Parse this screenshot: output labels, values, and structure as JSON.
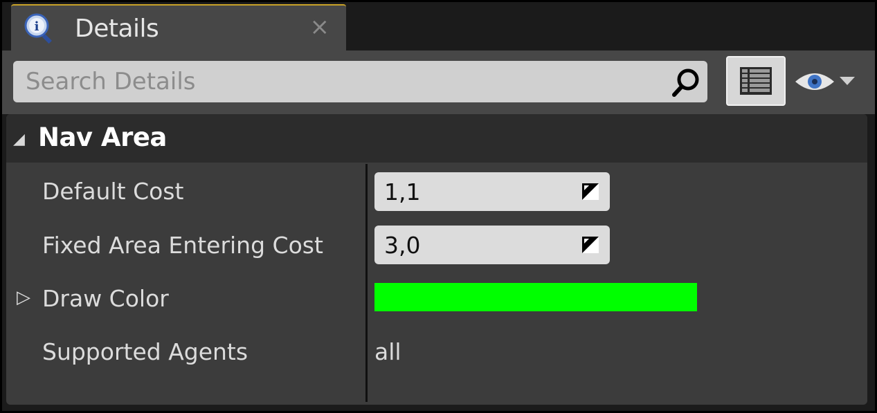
{
  "tab": {
    "title": "Details",
    "close": "×",
    "icon": "details-info-icon"
  },
  "toolbar": {
    "search_placeholder": "Search Details",
    "search_value": "",
    "search_icon": "magnifier-icon",
    "view_options_icon": "grid-view-icon",
    "visibility_icon": "eye-icon",
    "dropdown_icon": "chevron-down-icon"
  },
  "category": {
    "title": "Nav Area",
    "expanded": true
  },
  "properties": [
    {
      "label": "Default Cost",
      "value": "1,1",
      "type": "number"
    },
    {
      "label": "Fixed Area Entering Cost",
      "value": "3,0",
      "type": "number"
    },
    {
      "label": "Draw Color",
      "value_color": "#00ff00",
      "type": "color",
      "expandable": true,
      "expander": "▷"
    },
    {
      "label": "Supported Agents",
      "value": "all",
      "type": "text"
    }
  ],
  "colors": {
    "background": "#1b1b1b",
    "tab_active": "#474747",
    "tab_accent": "#c9a227",
    "panel": "#3c3c3c",
    "category_header": "#2c2c2c",
    "field": "#dcdcdc"
  }
}
